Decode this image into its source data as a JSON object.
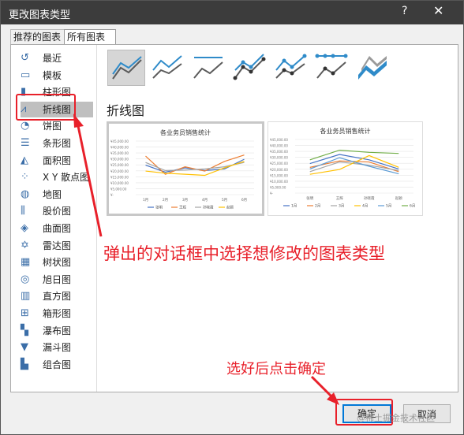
{
  "window": {
    "title": "更改图表类型",
    "help": "?",
    "close": "✕"
  },
  "tabs": [
    {
      "label": "推荐的图表"
    },
    {
      "label": "所有图表"
    }
  ],
  "sidebar": {
    "items": [
      {
        "label": "最近",
        "icon": "recent-icon"
      },
      {
        "label": "模板",
        "icon": "template-icon"
      },
      {
        "label": "柱形图",
        "icon": "column-chart-icon"
      },
      {
        "label": "折线图",
        "icon": "line-chart-icon",
        "selected": true
      },
      {
        "label": "饼图",
        "icon": "pie-chart-icon"
      },
      {
        "label": "条形图",
        "icon": "bar-chart-icon"
      },
      {
        "label": "面积图",
        "icon": "area-chart-icon"
      },
      {
        "label": "X Y 散点图",
        "icon": "scatter-chart-icon"
      },
      {
        "label": "地图",
        "icon": "map-chart-icon"
      },
      {
        "label": "股价图",
        "icon": "stock-chart-icon"
      },
      {
        "label": "曲面图",
        "icon": "surface-chart-icon"
      },
      {
        "label": "雷达图",
        "icon": "radar-chart-icon"
      },
      {
        "label": "树状图",
        "icon": "treemap-icon"
      },
      {
        "label": "旭日图",
        "icon": "sunburst-icon"
      },
      {
        "label": "直方图",
        "icon": "histogram-icon"
      },
      {
        "label": "箱形图",
        "icon": "box-whisker-icon"
      },
      {
        "label": "瀑布图",
        "icon": "waterfall-icon"
      },
      {
        "label": "漏斗图",
        "icon": "funnel-icon"
      },
      {
        "label": "组合图",
        "icon": "combo-chart-icon"
      }
    ]
  },
  "main": {
    "chart_type_title": "折线图",
    "preview_title": "各业务员销售统计",
    "preview1": {
      "xcats": [
        "1月",
        "2月",
        "3月",
        "4月",
        "5月",
        "6月"
      ],
      "legend": [
        "张明",
        "王辉",
        "孙晓霞",
        "赵颖"
      ]
    },
    "preview2": {
      "xcats": [
        "张明",
        "王辉",
        "孙晓霞",
        "赵颖"
      ],
      "legend": [
        "1月",
        "2月",
        "3月",
        "4月",
        "5月",
        "6月"
      ]
    },
    "yticks": [
      "¥45,000.00",
      "¥40,000.00",
      "¥35,000.00",
      "¥30,000.00",
      "¥25,000.00",
      "¥20,000.00",
      "¥15,000.00",
      "¥10,000.00",
      "¥5,000.00",
      "¥-"
    ]
  },
  "annotations": {
    "dialog_note": "弹出的对话框中选择想修改的图表类型",
    "ok_note": "选好后点击确定"
  },
  "buttons": {
    "ok": "确定",
    "cancel": "取消"
  },
  "watermark": "@稀土掘金技术社区",
  "colors": {
    "accent": "#e8202a",
    "series": [
      "#4472c4",
      "#ed7d31",
      "#a5a5a5",
      "#ffc000",
      "#5b9bd5",
      "#70ad47"
    ]
  }
}
